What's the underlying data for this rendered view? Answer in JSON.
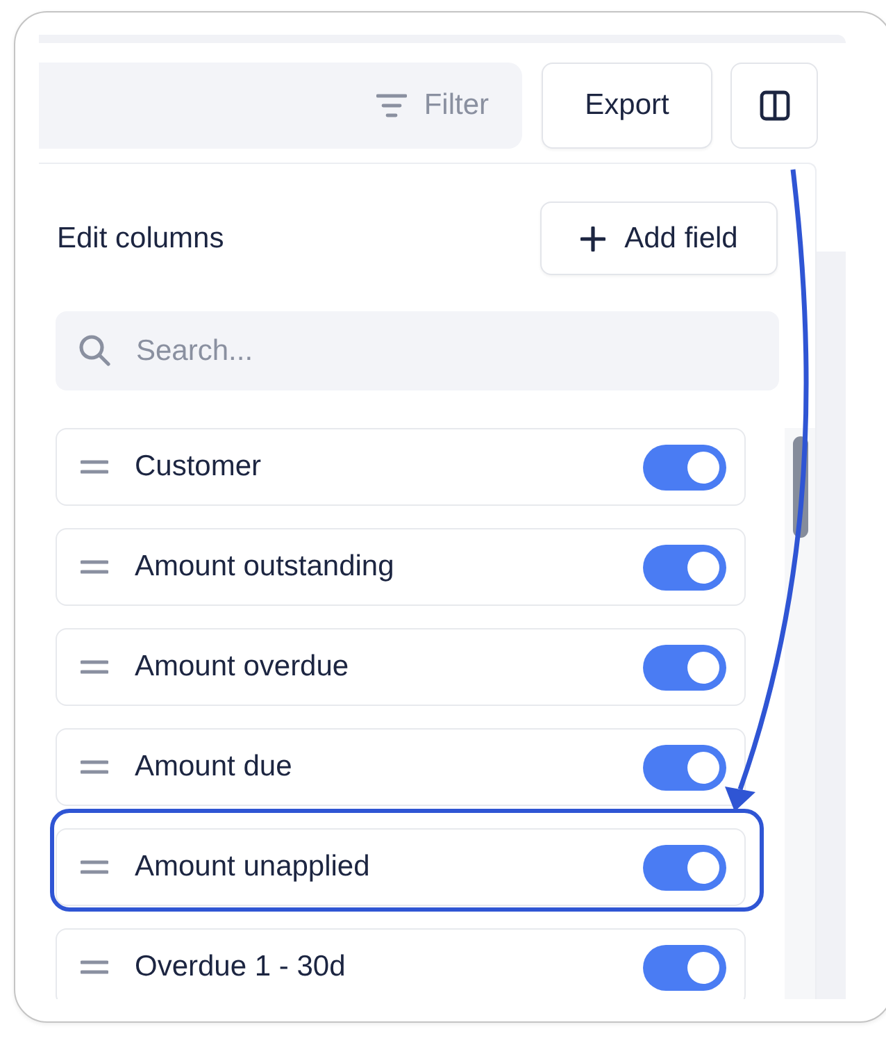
{
  "toolbar": {
    "filter_label": "Filter",
    "export_label": "Export"
  },
  "panel": {
    "title": "Edit columns",
    "add_label": "Add field",
    "search": {
      "placeholder": "Search..."
    },
    "columns": [
      {
        "name": "Customer",
        "on": true,
        "highlighted": false
      },
      {
        "name": "Amount outstanding",
        "on": true,
        "highlighted": false
      },
      {
        "name": "Amount overdue",
        "on": true,
        "highlighted": false
      },
      {
        "name": "Amount due",
        "on": true,
        "highlighted": false
      },
      {
        "name": "Amount unapplied",
        "on": true,
        "highlighted": true
      },
      {
        "name": "Overdue 1 - 30d",
        "on": true,
        "highlighted": false
      }
    ]
  }
}
